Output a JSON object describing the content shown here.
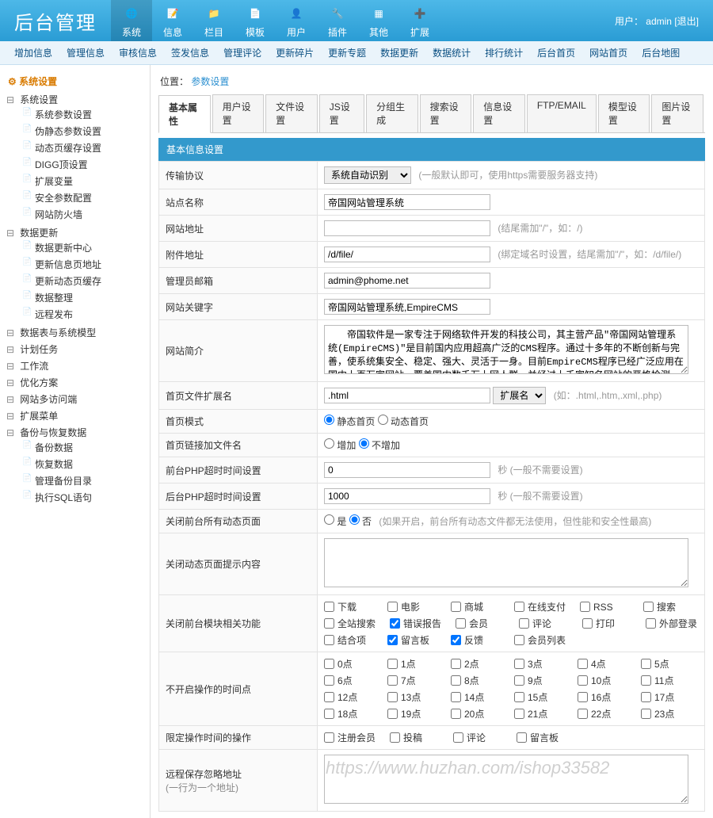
{
  "header": {
    "logo": "后台管理",
    "user_label": "用户：",
    "user_name": "admin",
    "logout": "[退出]",
    "nav": [
      {
        "label": "系统",
        "icon": "globe"
      },
      {
        "label": "信息",
        "icon": "edit"
      },
      {
        "label": "栏目",
        "icon": "folder"
      },
      {
        "label": "模板",
        "icon": "layers"
      },
      {
        "label": "用户",
        "icon": "user"
      },
      {
        "label": "插件",
        "icon": "plugin"
      },
      {
        "label": "其他",
        "icon": "grid"
      },
      {
        "label": "扩展",
        "icon": "plus"
      }
    ]
  },
  "subnav": [
    "增加信息",
    "管理信息",
    "审核信息",
    "签发信息",
    "管理评论",
    "更新碎片",
    "更新专题",
    "数据更新",
    "数据统计",
    "排行统计",
    "后台首页",
    "网站首页",
    "后台地图"
  ],
  "sidebar": {
    "title": "系统设置",
    "groups": [
      {
        "label": "系统设置",
        "items": [
          "系统参数设置",
          "伪静态参数设置",
          "动态页缓存设置",
          "DIGG顶设置",
          "扩展变量",
          "安全参数配置",
          "网站防火墙"
        ]
      },
      {
        "label": "数据更新",
        "items": [
          "数据更新中心",
          "更新信息页地址",
          "更新动态页缓存",
          "数据整理",
          "远程发布"
        ]
      },
      {
        "label": "数据表与系统模型",
        "items": []
      },
      {
        "label": "计划任务",
        "items": []
      },
      {
        "label": "工作流",
        "items": []
      },
      {
        "label": "优化方案",
        "items": []
      },
      {
        "label": "网站多访问端",
        "items": []
      },
      {
        "label": "扩展菜单",
        "items": []
      },
      {
        "label": "备份与恢复数据",
        "items": [
          "备份数据",
          "恢复数据",
          "管理备份目录",
          "执行SQL语句"
        ]
      }
    ]
  },
  "breadcrumb": {
    "label": "位置：",
    "current": "参数设置"
  },
  "tabs": [
    "基本属性",
    "用户设置",
    "文件设置",
    "JS设置",
    "分组生成",
    "搜索设置",
    "信息设置",
    "FTP/EMAIL",
    "模型设置",
    "图片设置"
  ],
  "section_title": "基本信息设置",
  "form": {
    "protocol_label": "传输协议",
    "protocol_value": "系统自动识别",
    "protocol_hint": "(一般默认即可，使用https需要服务器支持)",
    "sitename_label": "站点名称",
    "sitename_value": "帝国网站管理系统",
    "siteurl_label": "网站地址",
    "siteurl_value": "",
    "siteurl_hint": "(结尾需加\"/\"，如：/)",
    "fileurl_label": "附件地址",
    "fileurl_value": "/d/file/",
    "fileurl_hint": "(绑定域名时设置，结尾需加\"/\"，如：/d/file/)",
    "email_label": "管理员邮箱",
    "email_value": "admin@phome.net",
    "keywords_label": "网站关键字",
    "keywords_value": "帝国网站管理系统,EmpireCMS",
    "intro_label": "网站简介",
    "intro_value": "　　帝国软件是一家专注于网络软件开发的科技公司，其主营产品\"帝国网站管理系统(EmpireCMS)\"是目前国内应用超高广泛的CMS程序。通过十多年的不断创新与完善，使系统集安全、稳定、强大、灵活于一身。目前EmpireCMS程序已经广泛应用在国内上百万家网站，覆盖国内数千万上网人群，并经过上千家知名网站的严格检测，被称为国内超高安全、",
    "indexext_label": "首页文件扩展名",
    "indexext_value": ".html",
    "indexext_sel": "扩展名",
    "indexext_hint": "(如：.html,.htm,.xml,.php)",
    "indexmode_label": "首页模式",
    "indexmode_opt1": "静态首页",
    "indexmode_opt2": "动态首页",
    "indexlink_label": "首页链接加文件名",
    "indexlink_opt1": "增加",
    "indexlink_opt2": "不增加",
    "front_timeout_label": "前台PHP超时时间设置",
    "front_timeout_value": "0",
    "front_timeout_hint": "秒 (一般不需要设置)",
    "back_timeout_label": "后台PHP超时时间设置",
    "back_timeout_value": "1000",
    "back_timeout_hint": "秒 (一般不需要设置)",
    "close_dyn_label": "关闭前台所有动态页面",
    "close_dyn_opt1": "是",
    "close_dyn_opt2": "否",
    "close_dyn_hint": "(如果开启，前台所有动态文件都无法使用，但性能和安全性最高)",
    "close_dyn_msg_label": "关闭动态页面提示内容",
    "close_mod_label": "关闭前台模块相关功能",
    "close_mod_opts": [
      "下载",
      "电影",
      "商城",
      "在线支付",
      "RSS",
      "搜索",
      "全站搜索",
      "错误报告",
      "会员",
      "评论",
      "打印",
      "外部登录",
      "结合项",
      "留言板",
      "反馈",
      "会员列表"
    ],
    "close_mod_checked": [
      7,
      13,
      14
    ],
    "noopen_label": "不开启操作的时间点",
    "noopen_opts": [
      "0点",
      "1点",
      "2点",
      "3点",
      "4点",
      "5点",
      "6点",
      "7点",
      "8点",
      "9点",
      "10点",
      "11点",
      "12点",
      "13点",
      "14点",
      "15点",
      "16点",
      "17点",
      "18点",
      "19点",
      "20点",
      "21点",
      "22点",
      "23点"
    ],
    "limit_label": "限定操作时间的操作",
    "limit_opts": [
      "注册会员",
      "投稿",
      "评论",
      "留言板"
    ],
    "remote_label": "远程保存忽略地址",
    "remote_sub": "(一行为一个地址)",
    "remote_value": "https://www.huzhan.com/ishop33582"
  }
}
